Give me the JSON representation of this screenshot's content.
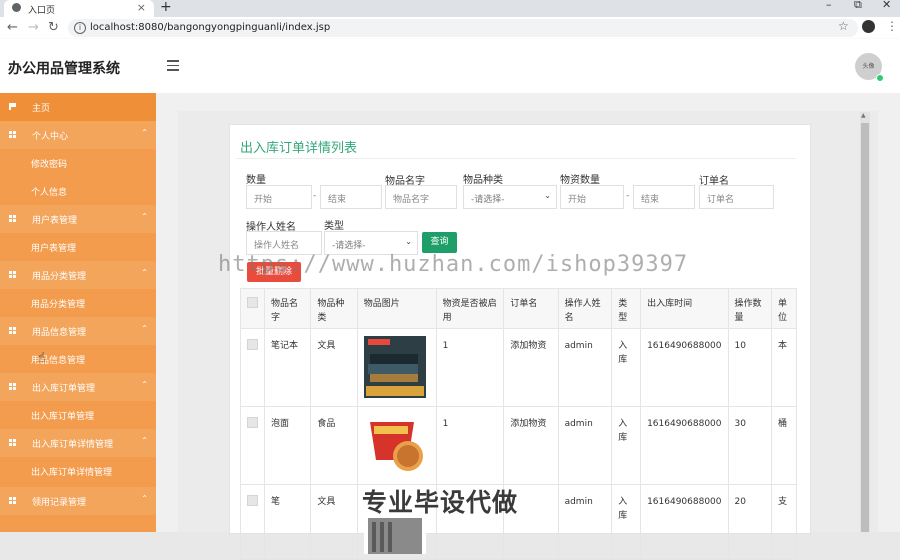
{
  "browser": {
    "tab_title": "入口页",
    "url": "localhost:8080/bangongyongpinguanli/index.jsp"
  },
  "header": {
    "brand": "办公用品管理系统",
    "avatar_text": "头像"
  },
  "sidebar": {
    "items": [
      {
        "label": "主页",
        "type": "home"
      },
      {
        "label": "个人中心",
        "type": "group"
      },
      {
        "label": "修改密码",
        "type": "sub"
      },
      {
        "label": "个人信息",
        "type": "sub"
      },
      {
        "label": "用户表管理",
        "type": "group"
      },
      {
        "label": "用户表管理",
        "type": "sub"
      },
      {
        "label": "用品分类管理",
        "type": "group"
      },
      {
        "label": "用品分类管理",
        "type": "sub"
      },
      {
        "label": "用品信息管理",
        "type": "group"
      },
      {
        "label": "用品信息管理",
        "type": "sub"
      },
      {
        "label": "出入库订单管理",
        "type": "group"
      },
      {
        "label": "出入库订单管理",
        "type": "sub"
      },
      {
        "label": "出入库订单详情管理",
        "type": "group"
      },
      {
        "label": "出入库订单详情管理",
        "type": "sub"
      },
      {
        "label": "领用记录管理",
        "type": "group"
      }
    ]
  },
  "page": {
    "title": "出入库订单详情列表",
    "filters": {
      "quantity_label": "数量",
      "quantity_start": "开始",
      "quantity_end": "结束",
      "item_name_label": "物品名字",
      "item_name_placeholder": "物品名字",
      "item_type_label": "物品种类",
      "item_type_select": "-请选择-",
      "supply_qty_label": "物资数量",
      "supply_qty_start": "开始",
      "supply_qty_end": "结束",
      "order_name_label": "订单名",
      "order_name_placeholder": "订单名",
      "operator_label": "操作人姓名",
      "operator_placeholder": "操作人姓名",
      "type_label": "类型",
      "type_select": "-请选择-",
      "dash": "-",
      "search_button": "查询",
      "delete_button": "批量删除"
    },
    "watermark": "https://www.huzhan.com/ishop39397",
    "bottom_watermark": "专业毕设代做",
    "table": {
      "headers": [
        "物品名字",
        "物品种类",
        "物品图片",
        "物资是否被启用",
        "订单名",
        "操作人姓名",
        "类型",
        "出入库时间",
        "操作数量",
        "单位"
      ],
      "rows": [
        {
          "name": "笔记本",
          "category": "文具",
          "image": "notebook-photo",
          "enabled": "1",
          "order": "添加物资",
          "operator": "admin",
          "type": "入库",
          "time": "1616490688000",
          "qty": "10",
          "unit": "本"
        },
        {
          "name": "泡面",
          "category": "食品",
          "image": "noodle-photo",
          "enabled": "1",
          "order": "添加物资",
          "operator": "admin",
          "type": "入库",
          "time": "1616490688000",
          "qty": "30",
          "unit": "桶"
        },
        {
          "name": "笔",
          "category": "文具",
          "image": "pen-photo",
          "enabled": "",
          "order": "",
          "operator": "admin",
          "type": "入库",
          "time": "1616490688000",
          "qty": "20",
          "unit": "支"
        }
      ]
    }
  },
  "colors": {
    "sidebar": "#f39c4d",
    "accent_green": "#1e9f6a",
    "title_green": "#33a77a",
    "danger": "#e74c3c"
  }
}
